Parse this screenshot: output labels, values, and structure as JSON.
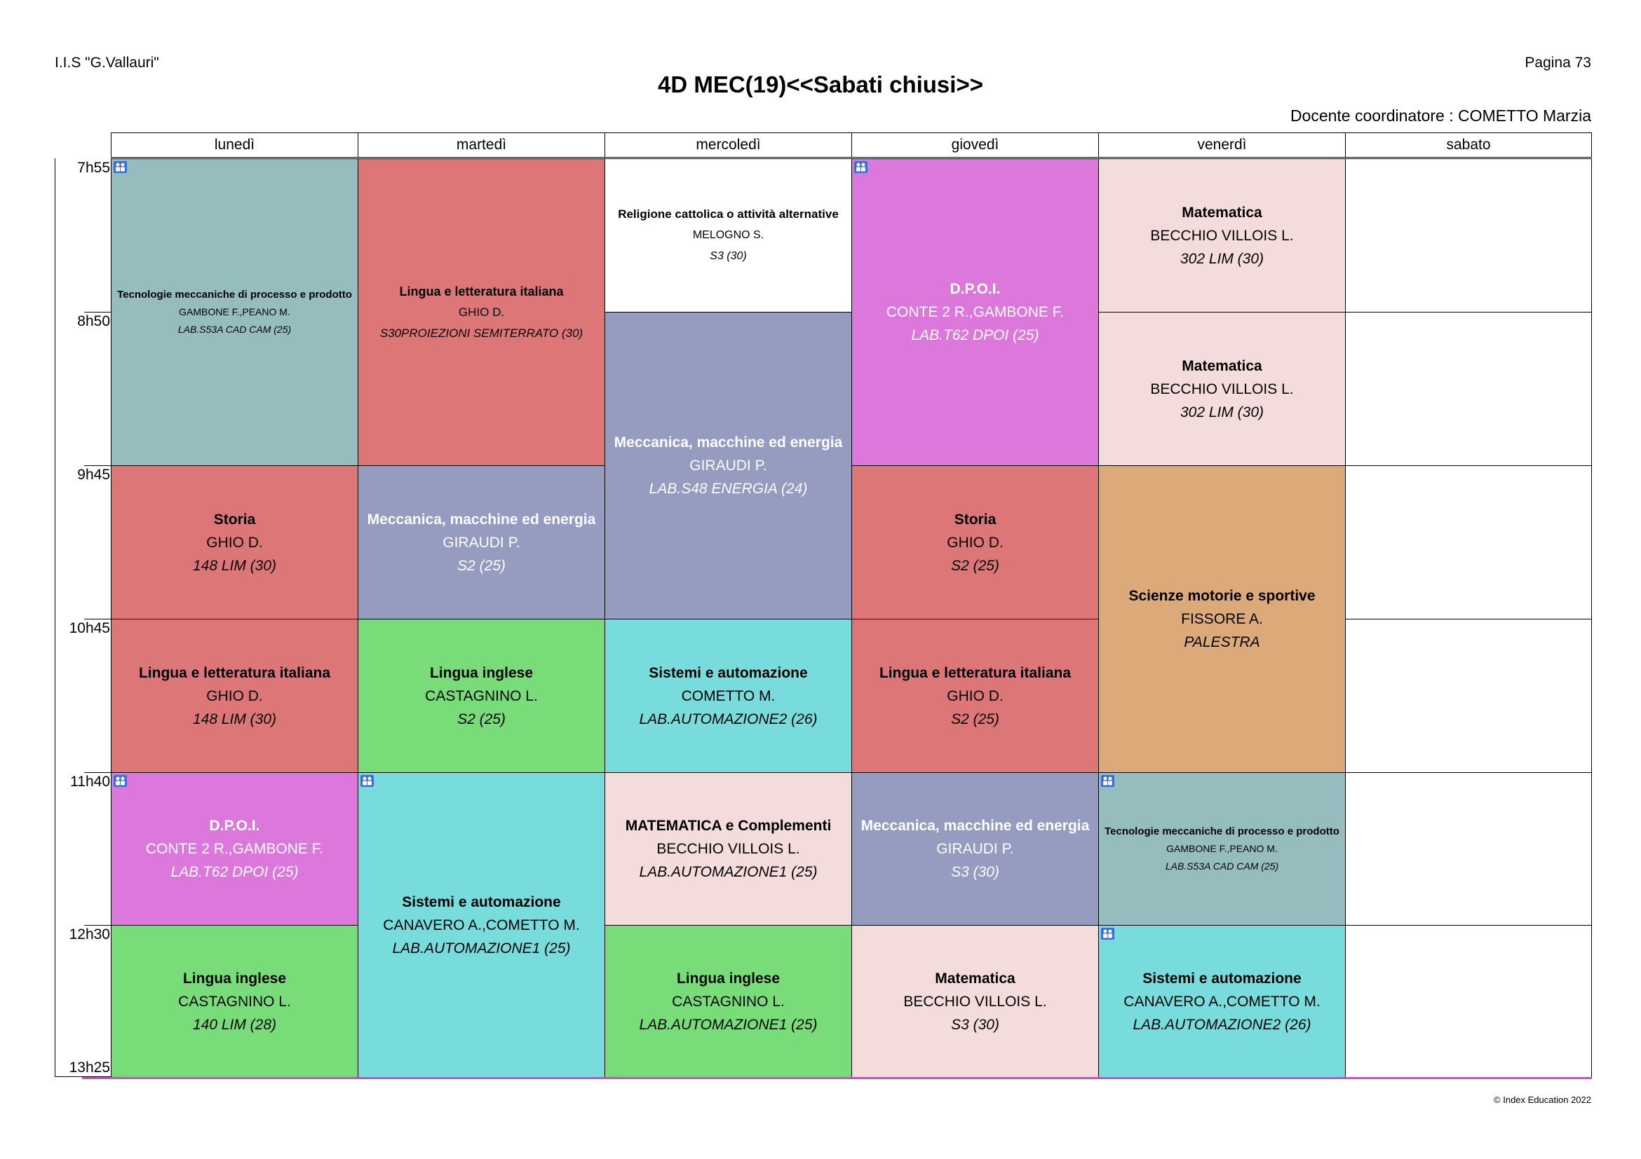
{
  "header": {
    "school": "I.I.S \"G.Vallauri\"",
    "page": "Pagina 73",
    "title": "4D MEC(19)<<Sabati chiusi>>",
    "coordinator": "Docente coordinatore : COMETTO Marzia"
  },
  "days": [
    "lunedì",
    "martedì",
    "mercoledì",
    "giovedì",
    "venerdì",
    "sabato"
  ],
  "times": [
    "7h55",
    "8h50",
    "9h45",
    "10h45",
    "11h40",
    "12h30",
    "13h25"
  ],
  "colors": {
    "teal_grey": "#95bdbd",
    "salmon": "#dd7777",
    "white": "#ffffff",
    "magenta": "#dc78dc",
    "pink": "#f5dcdc",
    "lavender": "#959cc0",
    "orange": "#dcaa78",
    "green": "#78dc78",
    "cyan": "#78dcdc",
    "bottom_line": "#e040e0"
  },
  "lessons": [
    {
      "subject": "Tecnologie meccaniche di processo e prodotto",
      "teacher": "GAMBONE F.,PEANO M.",
      "room": "LAB.S53A CAD CAM (25)",
      "group_icon": true
    },
    {
      "subject": "Lingua e letteratura italiana",
      "teacher": "GHIO D.",
      "room": "S30PROIEZIONI SEMITERRATO (30)",
      "group_icon": false
    },
    {
      "subject": "Religione cattolica o attività alternative",
      "teacher": "MELOGNO S.",
      "room": "S3 (30)",
      "group_icon": false
    },
    {
      "subject": "D.P.O.I.",
      "teacher": "CONTE 2 R.,GAMBONE F.",
      "room": "LAB.T62 DPOI (25)",
      "group_icon": true
    },
    {
      "subject": "Matematica",
      "teacher": "BECCHIO VILLOIS L.",
      "room": "302 LIM (30)",
      "group_icon": false
    },
    {
      "subject": "Meccanica, macchine ed energia",
      "teacher": "GIRAUDI P.",
      "room": "LAB.S48 ENERGIA (24)",
      "group_icon": false
    },
    {
      "subject": "Matematica",
      "teacher": "BECCHIO VILLOIS L.",
      "room": "302 LIM (30)",
      "group_icon": false
    },
    {
      "subject": "Storia",
      "teacher": "GHIO D.",
      "room": "148 LIM (30)",
      "group_icon": false
    },
    {
      "subject": "Meccanica, macchine ed energia",
      "teacher": "GIRAUDI P.",
      "room": "S2 (25)",
      "group_icon": false
    },
    {
      "subject": "Storia",
      "teacher": "GHIO D.",
      "room": "S2 (25)",
      "group_icon": false
    },
    {
      "subject": "Scienze motorie e sportive",
      "teacher": "FISSORE A.",
      "room": "PALESTRA",
      "group_icon": false
    },
    {
      "subject": "Lingua e letteratura italiana",
      "teacher": "GHIO D.",
      "room": "148 LIM (30)",
      "group_icon": false
    },
    {
      "subject": "Lingua inglese",
      "teacher": "CASTAGNINO L.",
      "room": "S2 (25)",
      "group_icon": false
    },
    {
      "subject": "Sistemi e automazione",
      "teacher": "COMETTO M.",
      "room": "LAB.AUTOMAZIONE2 (26)",
      "group_icon": false
    },
    {
      "subject": "Lingua e letteratura italiana",
      "teacher": "GHIO D.",
      "room": "S2 (25)",
      "group_icon": false
    },
    {
      "subject": "D.P.O.I.",
      "teacher": "CONTE 2 R.,GAMBONE F.",
      "room": "LAB.T62 DPOI (25)",
      "group_icon": true
    },
    {
      "subject": "Sistemi e automazione",
      "teacher": "CANAVERO A.,COMETTO M.",
      "room": "LAB.AUTOMAZIONE1 (25)",
      "group_icon": true
    },
    {
      "subject": "MATEMATICA e Complementi",
      "teacher": "BECCHIO VILLOIS L.",
      "room": "LAB.AUTOMAZIONE1 (25)",
      "group_icon": false
    },
    {
      "subject": "Meccanica, macchine ed energia",
      "teacher": "GIRAUDI P.",
      "room": "S3 (30)",
      "group_icon": false
    },
    {
      "subject": "Tecnologie meccaniche di processo e prodotto",
      "teacher": "GAMBONE F.,PEANO M.",
      "room": "LAB.S53A CAD CAM (25)",
      "group_icon": true
    },
    {
      "subject": "Lingua inglese",
      "teacher": "CASTAGNINO L.",
      "room": "140 LIM (28)",
      "group_icon": false
    },
    {
      "subject": "Lingua inglese",
      "teacher": "CASTAGNINO L.",
      "room": "LAB.AUTOMAZIONE1 (25)",
      "group_icon": false
    },
    {
      "subject": "Matematica",
      "teacher": "BECCHIO VILLOIS L.",
      "room": "S3 (30)",
      "group_icon": false
    },
    {
      "subject": "Sistemi e automazione",
      "teacher": "CANAVERO A.,COMETTO M.",
      "room": "LAB.AUTOMAZIONE2 (26)",
      "group_icon": true
    }
  ],
  "footer": {
    "copyright": "© Index Education 2022"
  }
}
